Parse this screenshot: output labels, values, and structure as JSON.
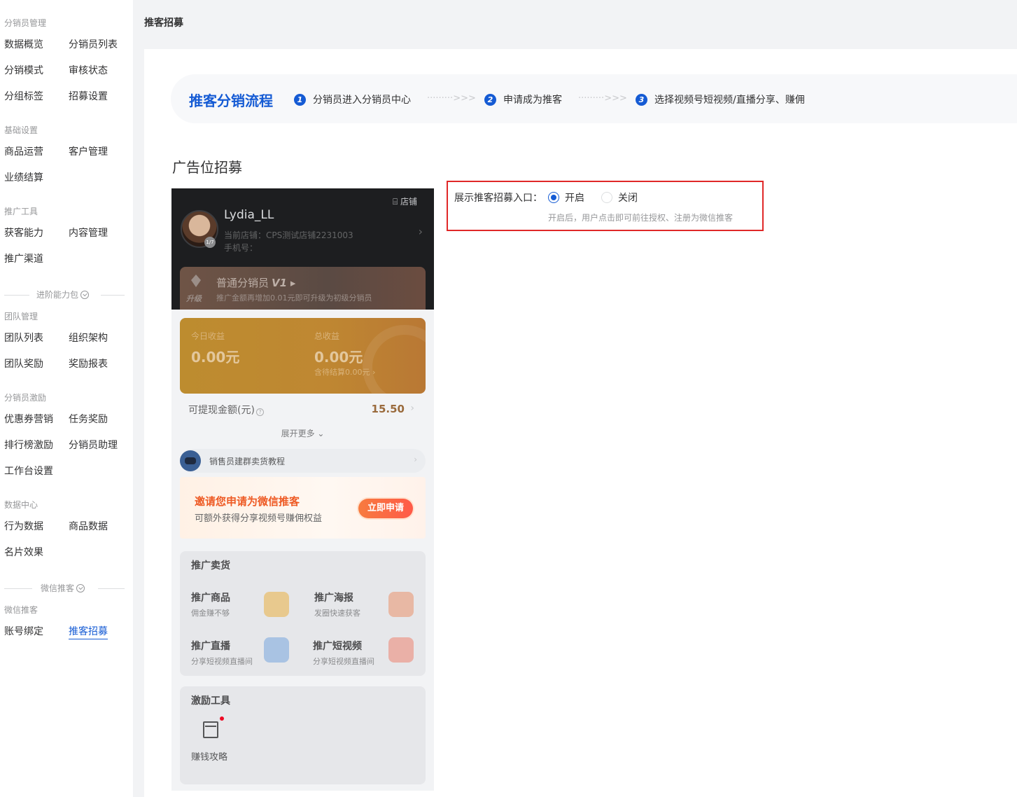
{
  "sidebar": {
    "groups": [
      {
        "title": "分销员管理",
        "items": [
          "数据概览",
          "分销员列表",
          "分销模式",
          "审核状态",
          "分组标签",
          "招募设置"
        ]
      },
      {
        "title": "基础设置",
        "items": [
          "商品运营",
          "客户管理",
          "业绩结算"
        ]
      },
      {
        "title": "推广工具",
        "items": [
          "获客能力",
          "内容管理",
          "推广渠道"
        ]
      },
      {
        "title": "团队管理",
        "items": [
          "团队列表",
          "组织架构",
          "团队奖励",
          "奖励报表"
        ]
      },
      {
        "title": "分销员激励",
        "items": [
          "优惠券营销",
          "任务奖励",
          "排行榜激励",
          "分销员助理",
          "工作台设置"
        ]
      },
      {
        "title": "数据中心",
        "items": [
          "行为数据",
          "商品数据",
          "名片效果"
        ]
      },
      {
        "title": "微信推客",
        "items": [
          "账号绑定",
          "推客招募"
        ]
      }
    ],
    "dividers": [
      "进阶能力包",
      "微信推客"
    ],
    "active_item": "推客招募"
  },
  "header": {
    "title": "推客招募"
  },
  "flow": {
    "title": "推客分销流程",
    "steps": [
      {
        "num": "1",
        "label": "分销员进入分销员中心"
      },
      {
        "num": "2",
        "label": "申请成为推客"
      },
      {
        "num": "3",
        "label": "选择视频号短视频/直播分享、赚佣"
      }
    ],
    "arrow": "·········>>>"
  },
  "section_title": "广告位招募",
  "phone": {
    "shop_link": "店铺",
    "user_name": "Lydia_LL",
    "shop_line": "当前店铺：CPS测试店铺2231003",
    "phone_line": "手机号：",
    "avatar_badge": "1/7",
    "level_name": "普通分销员",
    "level_tag": "V1",
    "level_desc": "推广金额再增加0.01元即可升级为初级分销员",
    "upgrade_label": "升级",
    "today_income_label": "今日收益",
    "today_income_value": "0.00元",
    "total_income_label": "总收益",
    "total_income_value": "0.00元",
    "pending_settlement": "含待结算0.00元 ›",
    "withdraw_label": "可提现金额(元)",
    "withdraw_value": "15.50",
    "expand_more": "展开更多 ⌄",
    "tutorial": "销售员建群卖货教程",
    "invite_title": "邀请您申请为微信推客",
    "invite_sub": "可额外获得分享视频号赚佣权益",
    "invite_button": "立即申请",
    "promo_title": "推广卖货",
    "promo_items": [
      {
        "name": "推广商品",
        "desc": "佣金赚不够"
      },
      {
        "name": "推广海报",
        "desc": "发圈快速获客"
      },
      {
        "name": "推广直播",
        "desc": "分享短视频直播间"
      },
      {
        "name": "推广短视频",
        "desc": "分享短视频直播间"
      }
    ],
    "incentive_title": "激励工具",
    "strategy_label": "赚钱攻略"
  },
  "setting": {
    "label": "展示推客招募入口：",
    "option_on": "开启",
    "option_off": "关闭",
    "selected": "开启",
    "hint": "开启后，用户点击即可前往授权、注册为微信推客"
  },
  "colors": {
    "accent": "#155bd4",
    "highlight_border": "#e02828",
    "invite_orange": "#ee5a24"
  }
}
